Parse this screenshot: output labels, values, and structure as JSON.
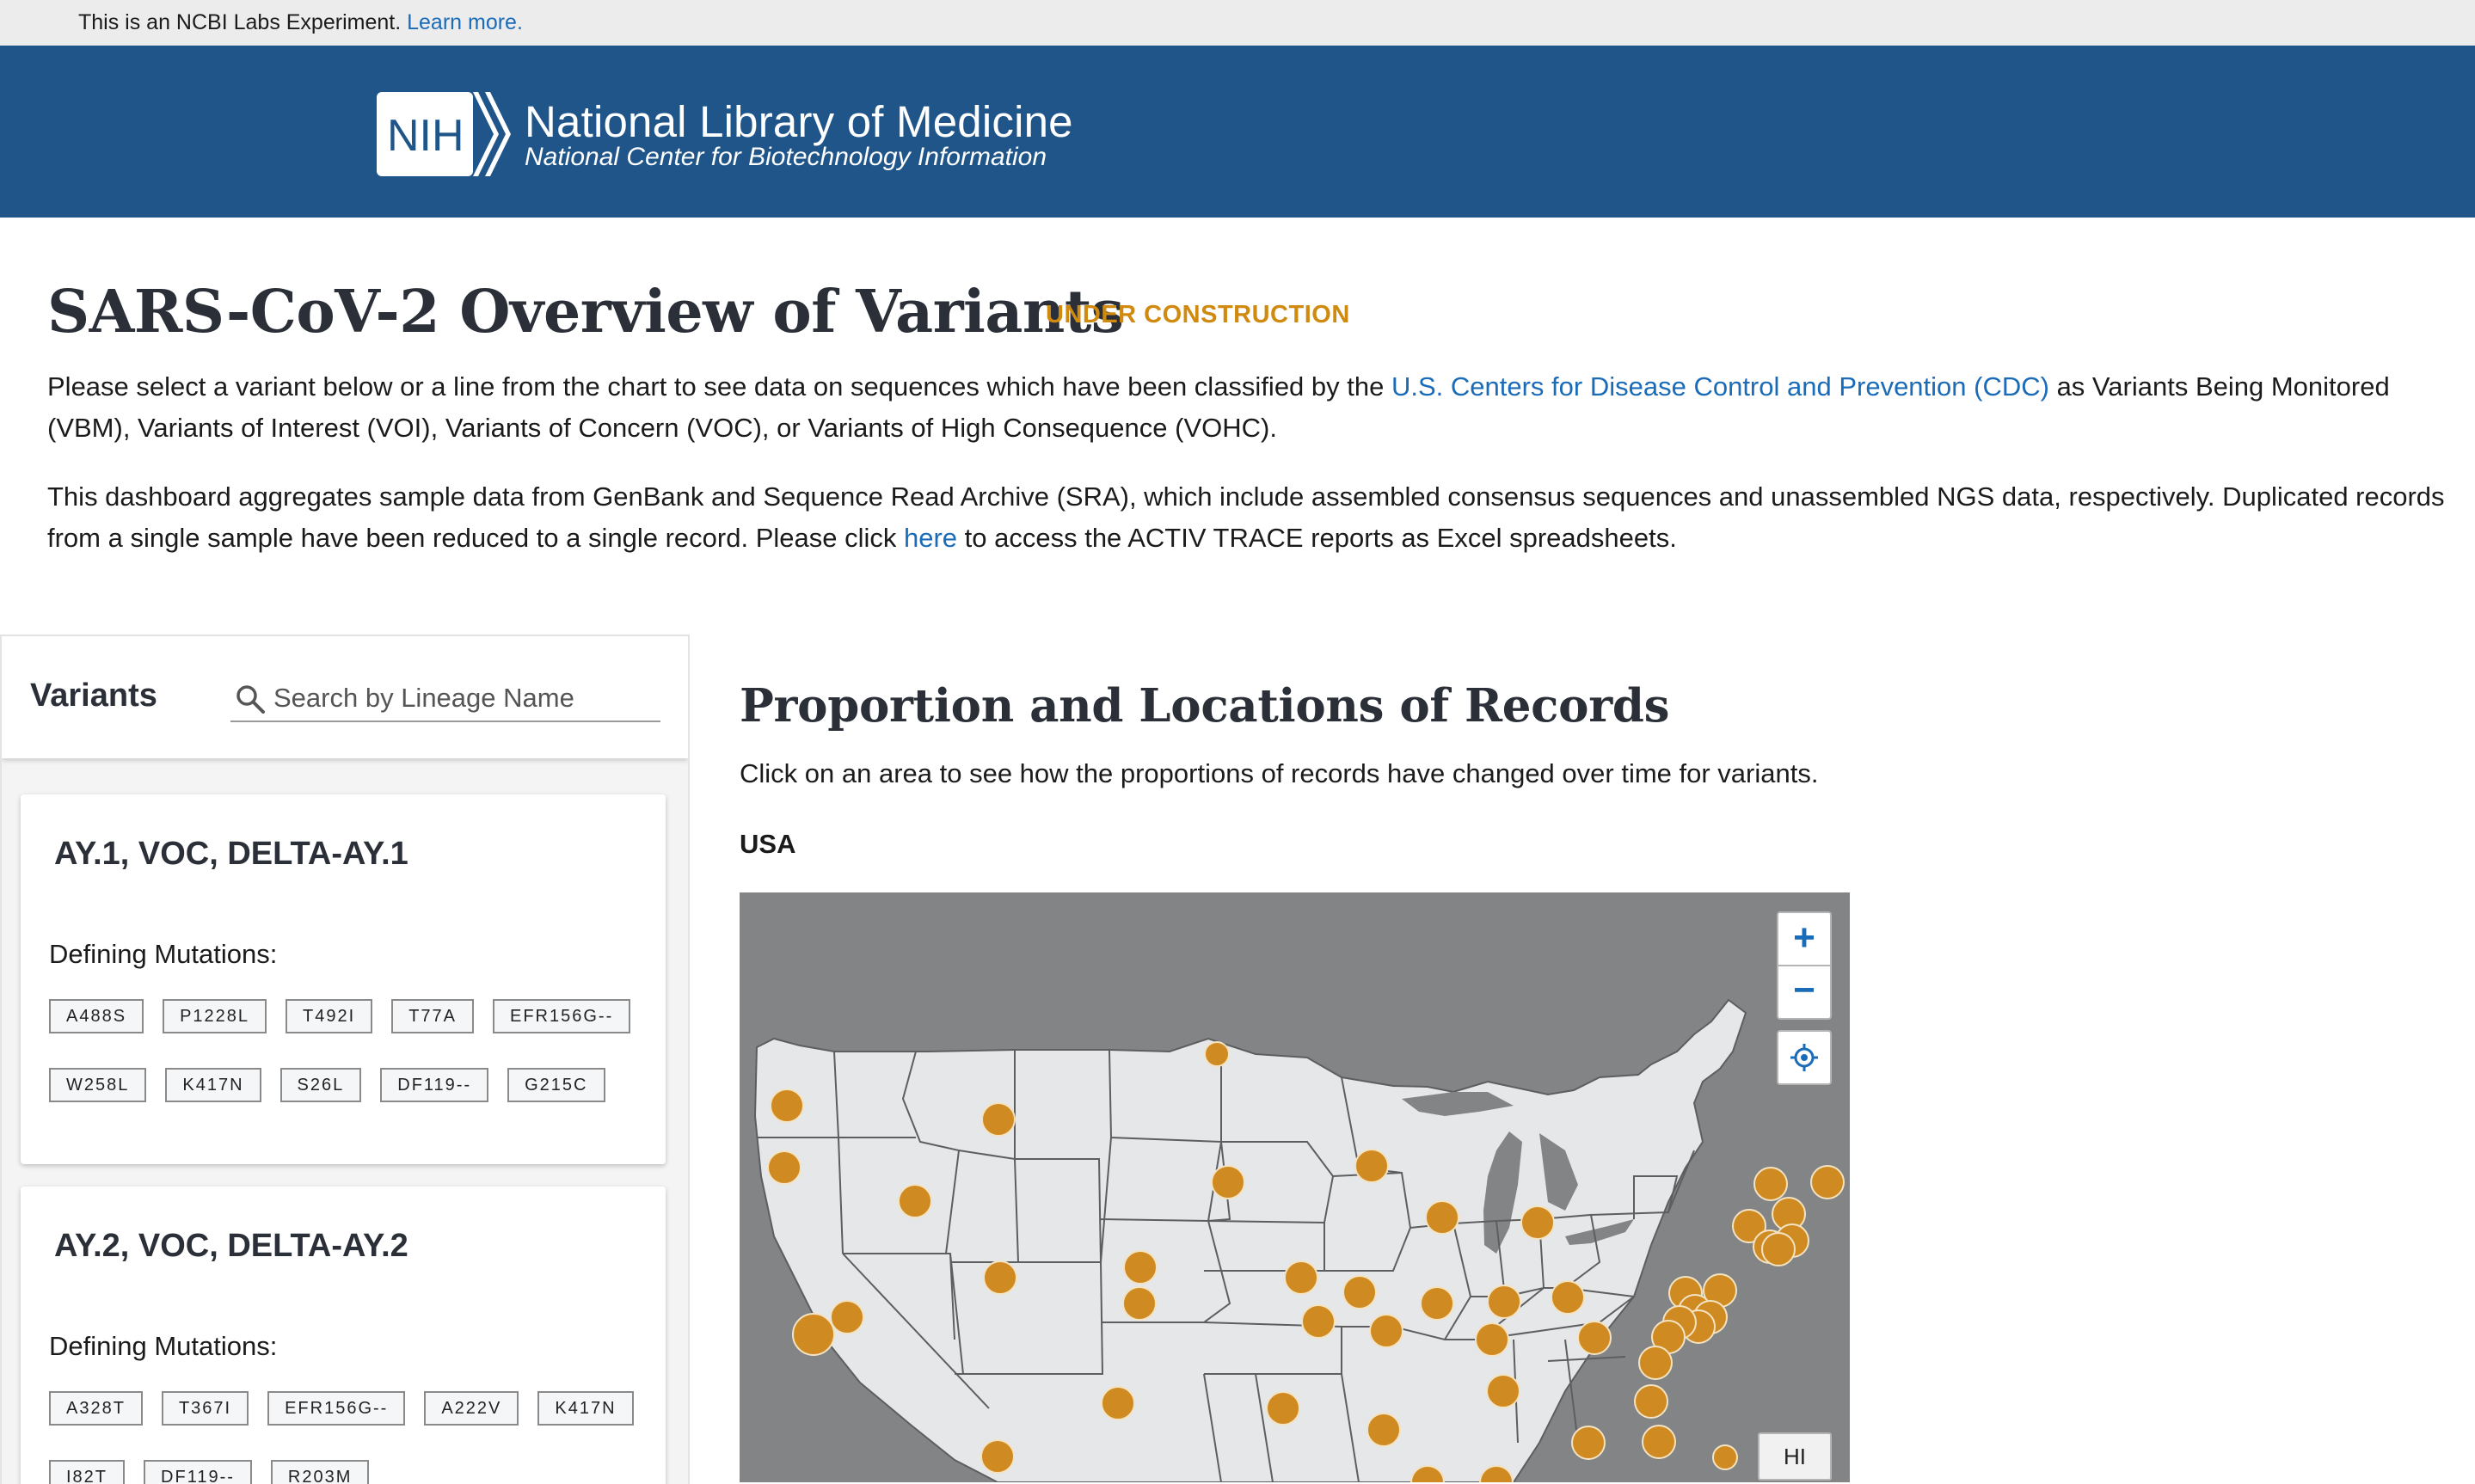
{
  "labs_bar": {
    "text": "This is an NCBI Labs Experiment.",
    "link": "Learn more."
  },
  "header": {
    "logo_text": "NIH",
    "title": "National Library of Medicine",
    "subtitle": "National Center for Biotechnology Information",
    "colors": {
      "header_bg": "#20558a",
      "accent": "#d08a0f",
      "link": "#1a6bb8"
    }
  },
  "page": {
    "title": "SARS-CoV-2  Overview of Variants",
    "badge": "UNDER CONSTRUCTION",
    "intro1_part1": "Please select a variant below or a line from the chart to see data on sequences which have been classified by the ",
    "intro1_link": "U.S. Centers for Disease Control and Prevention (CDC)",
    "intro1_part2": " as Variants Being Monitored (VBM), Variants of Interest (VOI), Variants of Concern (VOC), or Variants of High Consequence (VOHC).",
    "intro2_part1": "This dashboard aggregates sample data from GenBank and Sequence Read Archive (SRA), which include assembled consensus sequences and unassembled NGS data, respectively. Duplicated records from a single sample have been reduced to a single record. Please click ",
    "intro2_link": "here",
    "intro2_part2": " to access the ACTIV TRACE reports as Excel spreadsheets."
  },
  "variants": {
    "title": "Variants",
    "search_placeholder": "Search by Lineage Name",
    "search_icon": "search-icon",
    "mutations_label": "Defining Mutations:",
    "cards": [
      {
        "title": "AY.1, VOC, DELTA-AY.1",
        "rows": [
          [
            "A488S",
            "P1228L",
            "T492I",
            "T77A",
            "EFR156G--"
          ],
          [
            "W258L",
            "K417N",
            "S26L",
            "DF119--",
            "G215C"
          ]
        ]
      },
      {
        "title": "AY.2, VOC, DELTA-AY.2",
        "rows": [
          [
            "A328T",
            "T367I",
            "EFR156G--",
            "A222V",
            "K417N"
          ],
          [
            "I82T",
            "DF119--",
            "R203M"
          ]
        ]
      }
    ]
  },
  "map": {
    "title": "Proportion and Locations of Records",
    "description": "Click on an area to see how the proportions of records have changed over time for variants.",
    "region": "USA",
    "zoom_in": "+",
    "zoom_out": "−",
    "locate_icon": "crosshair-icon",
    "hi_label": "HI",
    "marker_color": "#d08a22"
  }
}
